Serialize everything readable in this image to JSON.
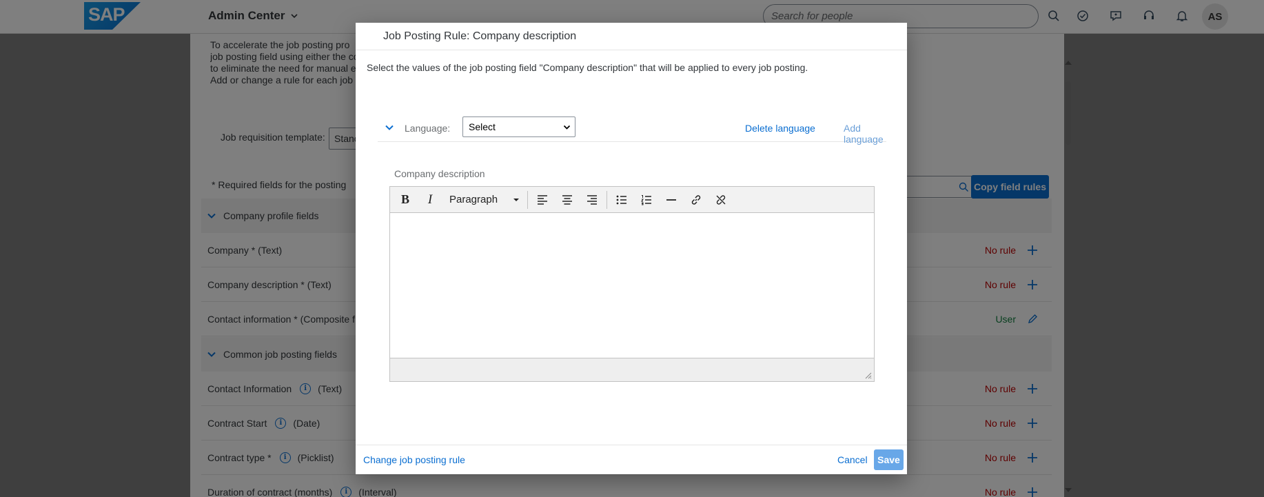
{
  "header": {
    "logo_text": "SAP",
    "app_title": "Admin Center",
    "search_placeholder": "Search for people",
    "avatar_initials": "AS",
    "icons": [
      "search-icon",
      "approvals-icon",
      "feedback-icon",
      "support-icon",
      "notifications-icon"
    ]
  },
  "background": {
    "intro_lines": [
      "To accelerate the job posting pro",
      "job posting field using either the co",
      "to eliminate the need for manual e",
      "Add or change a rule for each job"
    ],
    "template_label": "Job requisition template:",
    "template_value": "Stanc",
    "required_label": "* Required fields for the posting",
    "copy_button": "Copy field rules",
    "groups": [
      {
        "label": "Company profile fields"
      },
      {
        "label": "Common job posting fields"
      }
    ],
    "rows": [
      {
        "label": "Company * (Text)",
        "status": "No rule"
      },
      {
        "label": "Company description * (Text)",
        "status": "No rule"
      },
      {
        "label": "Contact information * (Composite f",
        "status": "User"
      },
      {
        "label": "Contact Information",
        "type": "(Text)",
        "status": "No rule"
      },
      {
        "label": "Contract Start",
        "type": "(Date)",
        "status": "No rule"
      },
      {
        "label": "Contract type *",
        "type": "(Picklist)",
        "status": "No rule"
      },
      {
        "label": "Duration of contract (months)",
        "type": "(Interval)",
        "status": "No rule"
      }
    ],
    "info_glyph": "i"
  },
  "dialog": {
    "title": "Job Posting Rule: Company description",
    "description": "Select the values of the job posting field \"Company description\" that will be applied to every job posting.",
    "language_label": "Language:",
    "language_value": "Select",
    "delete_language": "Delete language",
    "add_language": "Add language",
    "field_label": "Company description",
    "editor": {
      "bold": "B",
      "italic": "I",
      "paragraph_value": "Paragraph"
    },
    "change_rule_link": "Change job posting rule",
    "cancel": "Cancel",
    "save": "Save"
  }
}
